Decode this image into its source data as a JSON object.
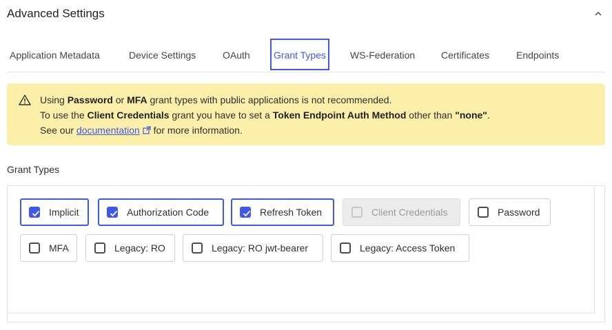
{
  "header": {
    "title": "Advanced Settings"
  },
  "tabs": [
    {
      "label": "Application Metadata",
      "active": false
    },
    {
      "label": "Device Settings",
      "active": false
    },
    {
      "label": "OAuth",
      "active": false
    },
    {
      "label": "Grant Types",
      "active": true
    },
    {
      "label": "WS-Federation",
      "active": false
    },
    {
      "label": "Certificates",
      "active": false
    },
    {
      "label": "Endpoints",
      "active": false
    }
  ],
  "alert": {
    "line1": {
      "pre": "Using ",
      "b1": "Password",
      "mid": " or ",
      "b2": "MFA",
      "post": " grant types with public applications is not recommended."
    },
    "line2": {
      "pre": "To use the ",
      "b1": "Client Credentials",
      "mid": " grant you have to set a ",
      "b2": "Token Endpoint Auth Method",
      "mid2": " other than ",
      "b3": "\"none\"",
      "post": "."
    },
    "line3": {
      "pre": "See our ",
      "link": "documentation",
      "post": " for more information."
    }
  },
  "grant_section": {
    "label": "Grant Types",
    "options": [
      {
        "label": "Implicit",
        "checked": true,
        "disabled": false
      },
      {
        "label": "Authorization Code",
        "checked": true,
        "disabled": false
      },
      {
        "label": "Refresh Token",
        "checked": true,
        "disabled": false
      },
      {
        "label": "Client Credentials",
        "checked": false,
        "disabled": true
      },
      {
        "label": "Password",
        "checked": false,
        "disabled": false
      },
      {
        "label": "MFA",
        "checked": false,
        "disabled": false
      },
      {
        "label": "Legacy: RO",
        "checked": false,
        "disabled": false
      },
      {
        "label": "Legacy: RO jwt-bearer",
        "checked": false,
        "disabled": false
      },
      {
        "label": "Legacy: Access Token",
        "checked": false,
        "disabled": false
      }
    ]
  },
  "colors": {
    "accent": "#3f59e4",
    "warning_bg": "#fbefaa"
  }
}
